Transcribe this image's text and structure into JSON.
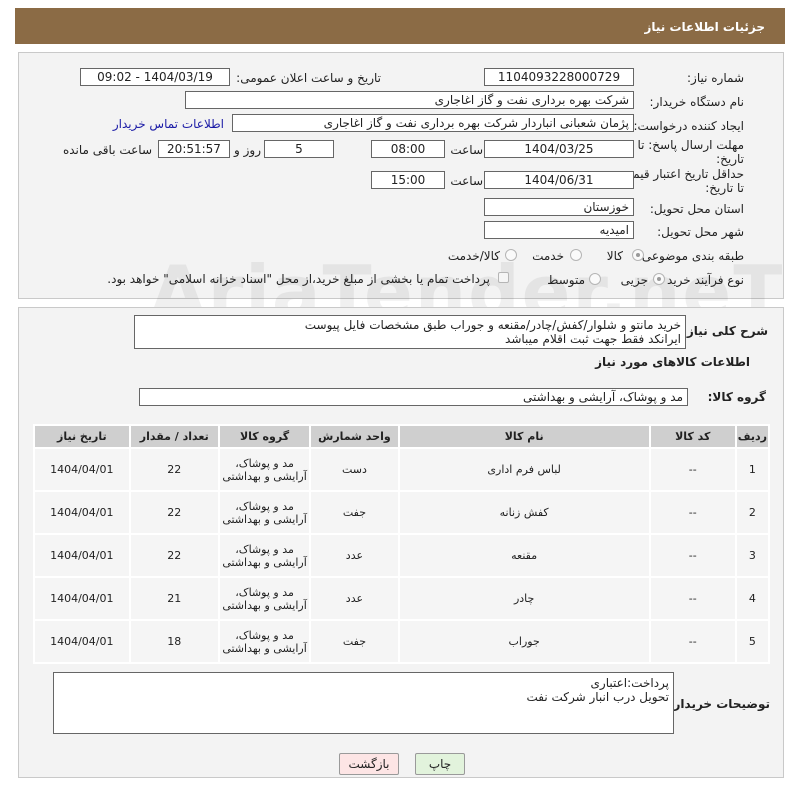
{
  "header": {
    "title": "جزئیات اطلاعات نیاز"
  },
  "form": {
    "need_number_label": "شماره نیاز:",
    "need_number": "1104093228000729",
    "announce_label": "تاریخ و ساعت اعلان عمومی:",
    "announce_value": "1404/03/19 - 09:02",
    "buyer_org_label": "نام دستگاه خریدار:",
    "buyer_org": "شرکت بهره برداری نفت و گاز اغاجاری",
    "creator_label": "ایجاد کننده درخواست:",
    "creator": "پژمان شعبانی انباردار شرکت بهره برداری نفت و گاز اغاجاری",
    "contact_link": "اطلاعات تماس خریدار",
    "deadline_label_1": "مهلت ارسال پاسخ: تا",
    "deadline_label_2": "تاریخ:",
    "deadline_date": "1404/03/25",
    "time_label": "ساعت",
    "deadline_time": "08:00",
    "days_value": "5",
    "days_label": "روز و",
    "remaining_time": "20:51:57",
    "remaining_label": "ساعت باقی مانده",
    "validity_label_1": "حداقل تاریخ اعتبار قیمت:",
    "validity_label_2": "تا تاریخ:",
    "validity_date": "1404/06/31",
    "validity_time": "15:00",
    "province_label": "استان محل تحویل:",
    "province": "خوزستان",
    "city_label": "شهر محل تحویل:",
    "city": "امیدیه",
    "category_label": "طبقه بندی موضوعی:",
    "category_options": [
      "کالا",
      "خدمت",
      "کالا/خدمت"
    ],
    "process_label": "نوع فرآیند خرید :",
    "process_options": [
      "جزیی",
      "متوسط"
    ],
    "payment_note": "پرداخت تمام یا بخشی از مبلغ خرید،از محل \"اسناد خزانه اسلامی\" خواهد بود."
  },
  "description": {
    "label": "شرح کلی نیاز:",
    "text_line1": "خرید مانتو و شلوار/کفش/چادر/مقنعه و جوراب طبق مشخصات فایل پیوست",
    "text_line2": "ایرانکد فقط جهت ثبت اقلام میباشد",
    "goods_info_title": "اطلاعات کالاهای مورد نیاز",
    "goods_group_label": "گروه کالا:",
    "goods_group": "مد و پوشاک، آرایشی و بهداشتی"
  },
  "table": {
    "headers": [
      "ردیف",
      "کد کالا",
      "نام کالا",
      "واحد شمارش",
      "گروه کالا",
      "تعداد / مقدار",
      "تاریخ نیاز"
    ],
    "rows": [
      {
        "idx": "1",
        "code": "--",
        "name": "لباس فرم اداری",
        "unit": "دست",
        "group": "مد و پوشاک، آرایشی و بهداشتی",
        "qty": "22",
        "date": "1404/04/01"
      },
      {
        "idx": "2",
        "code": "--",
        "name": "کفش زنانه",
        "unit": "جفت",
        "group": "مد و پوشاک، آرایشی و بهداشتی",
        "qty": "22",
        "date": "1404/04/01"
      },
      {
        "idx": "3",
        "code": "--",
        "name": "مقنعه",
        "unit": "عدد",
        "group": "مد و پوشاک، آرایشی و بهداشتی",
        "qty": "22",
        "date": "1404/04/01"
      },
      {
        "idx": "4",
        "code": "--",
        "name": "چادر",
        "unit": "عدد",
        "group": "مد و پوشاک، آرایشی و بهداشتی",
        "qty": "21",
        "date": "1404/04/01"
      },
      {
        "idx": "5",
        "code": "--",
        "name": "جوراب",
        "unit": "جفت",
        "group": "مد و پوشاک، آرایشی و بهداشتی",
        "qty": "18",
        "date": "1404/04/01"
      }
    ]
  },
  "buyer_notes": {
    "label": "توضیحات خریدار:",
    "line1": "پرداخت:اعتباری",
    "line2": "تحویل درب انبار شرکت نفت"
  },
  "buttons": {
    "print": "چاپ",
    "back": "بازگشت"
  },
  "watermark": "AriaTender.neT",
  "colors": {
    "header_bg": "#8b6b45",
    "link": "#1a1aa6",
    "back_button_bg": "#fde5e5",
    "print_button_bg": "#e2f3dc"
  }
}
